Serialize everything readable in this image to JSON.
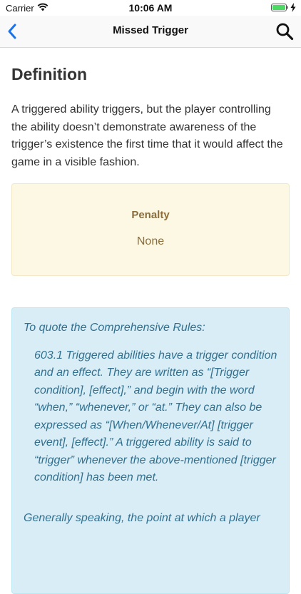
{
  "status_bar": {
    "carrier": "Carrier",
    "time": "10:06 AM"
  },
  "nav": {
    "title": "Missed Trigger"
  },
  "definition": {
    "heading": "Definition",
    "text": "A triggered ability triggers, but the player controlling the ability doesn’t demonstrate awareness of the trigger’s existence the first time that it would affect the game in a visible fashion."
  },
  "penalty": {
    "label": "Penalty",
    "value": "None"
  },
  "quote": {
    "intro": "To quote the Comprehensive Rules:",
    "rule_number": "603.1",
    "rule_text": " Triggered abilities have a trigger condition and an effect. They are written as “[Trigger condition], [effect],” and begin with the word “when,” “whenever,” or “at.” They can also be expressed as “[When/Whenever/At] [trigger event], [effect].” A triggered ability is said to “trigger” whenever the above-mentioned [trigger condition] has been met.",
    "tail": "Generally speaking, the point at which a player"
  },
  "colors": {
    "penalty_bg": "#fcf8e3",
    "penalty_text": "#8a6d3b",
    "quote_bg": "#d9edf7",
    "quote_text": "#31708f",
    "nav_accent": "#1a73e8"
  }
}
